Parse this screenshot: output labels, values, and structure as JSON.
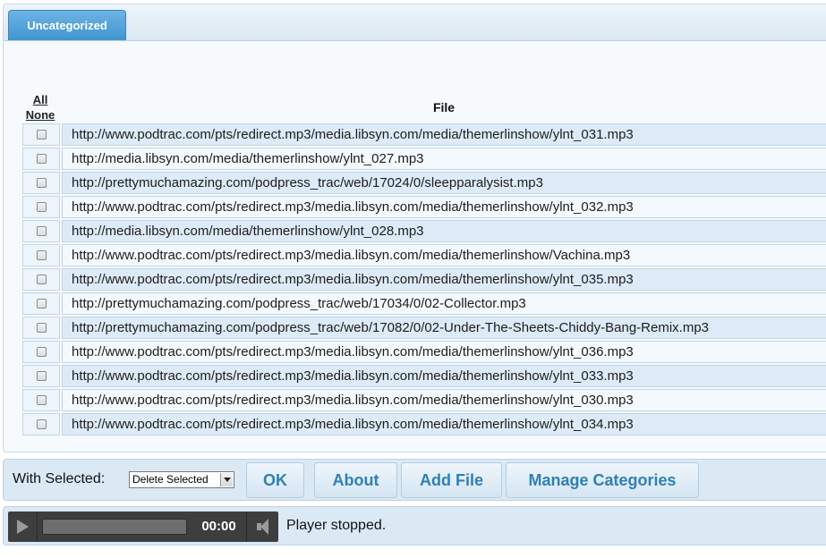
{
  "tabs": [
    {
      "label": "Uncategorized",
      "active": true
    }
  ],
  "table": {
    "select_all": "All",
    "select_none": "None",
    "file_header": "File",
    "rows": [
      {
        "url": "http://www.podtrac.com/pts/redirect.mp3/media.libsyn.com/media/themerlinshow/ylnt_031.mp3",
        "checked": false
      },
      {
        "url": "http://media.libsyn.com/media/themerlinshow/ylnt_027.mp3",
        "checked": false
      },
      {
        "url": "http://prettymuchamazing.com/podpress_trac/web/17024/0/sleepparalysist.mp3",
        "checked": false
      },
      {
        "url": "http://www.podtrac.com/pts/redirect.mp3/media.libsyn.com/media/themerlinshow/ylnt_032.mp3",
        "checked": false
      },
      {
        "url": "http://media.libsyn.com/media/themerlinshow/ylnt_028.mp3",
        "checked": false
      },
      {
        "url": "http://www.podtrac.com/pts/redirect.mp3/media.libsyn.com/media/themerlinshow/Vachina.mp3",
        "checked": false
      },
      {
        "url": "http://www.podtrac.com/pts/redirect.mp3/media.libsyn.com/media/themerlinshow/ylnt_035.mp3",
        "checked": false
      },
      {
        "url": "http://prettymuchamazing.com/podpress_trac/web/17034/0/02-Collector.mp3",
        "checked": false
      },
      {
        "url": "http://prettymuchamazing.com/podpress_trac/web/17082/0/02-Under-The-Sheets-Chiddy-Bang-Remix.mp3",
        "checked": false
      },
      {
        "url": "http://www.podtrac.com/pts/redirect.mp3/media.libsyn.com/media/themerlinshow/ylnt_036.mp3",
        "checked": false
      },
      {
        "url": "http://www.podtrac.com/pts/redirect.mp3/media.libsyn.com/media/themerlinshow/ylnt_033.mp3",
        "checked": false
      },
      {
        "url": "http://www.podtrac.com/pts/redirect.mp3/media.libsyn.com/media/themerlinshow/ylnt_030.mp3",
        "checked": false
      },
      {
        "url": "http://www.podtrac.com/pts/redirect.mp3/media.libsyn.com/media/themerlinshow/ylnt_034.mp3",
        "checked": false
      }
    ]
  },
  "actions": {
    "with_selected_label": "With Selected:",
    "selected_action": "Delete Selected",
    "ok_label": "OK",
    "about_label": "About",
    "add_file_label": "Add File",
    "manage_categories_label": "Manage Categories"
  },
  "player": {
    "time": "00:00",
    "progress": 0,
    "status": "Player stopped.",
    "icons": [
      "play-icon",
      "volume-icon"
    ]
  },
  "colors": {
    "tab_active": "#4a9fd8",
    "button_text": "#2f80b6",
    "row_blue": "#dcebf7",
    "row_light": "#f4f9fd",
    "player_bg": "#3e3e3e"
  }
}
